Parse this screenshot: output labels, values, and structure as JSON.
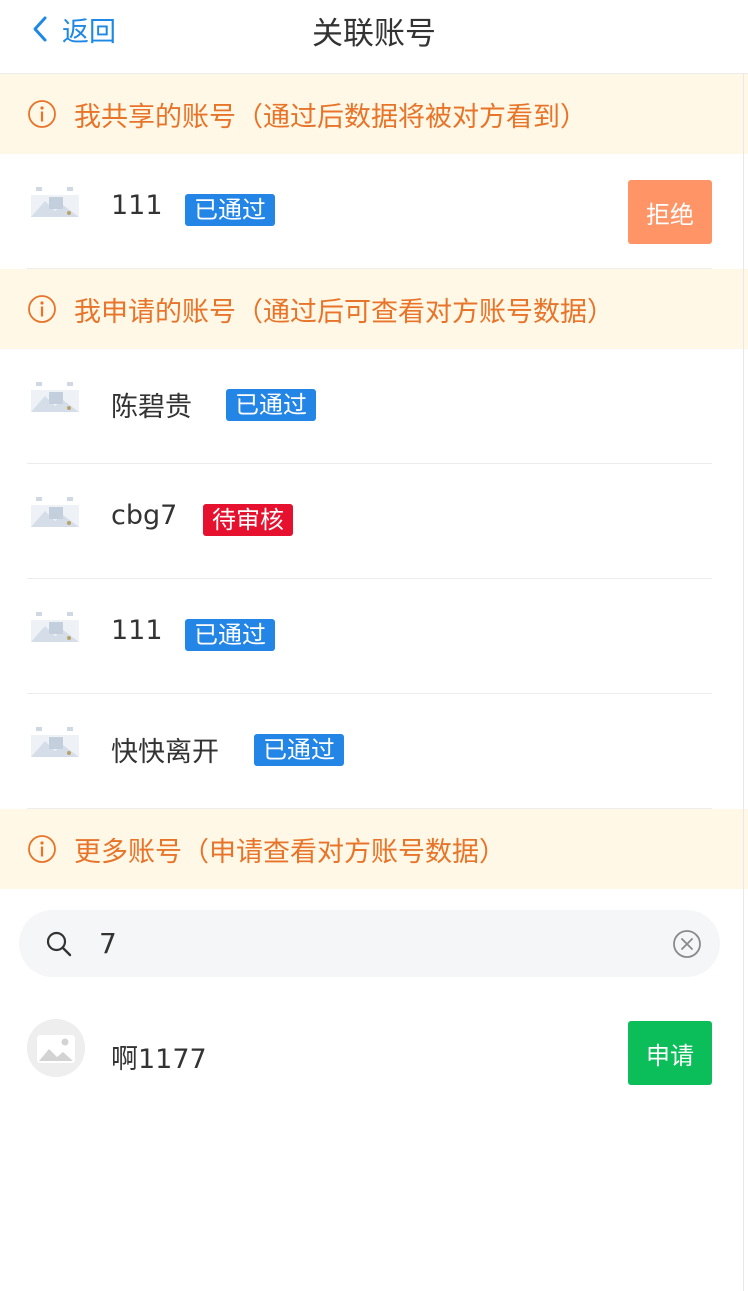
{
  "header": {
    "back_label": "返回",
    "title": "关联账号"
  },
  "sections": {
    "shared": {
      "notice": "我共享的账号（通过后数据将被对方看到）"
    },
    "applied": {
      "notice": "我申请的账号（通过后可查看对方账号数据）"
    },
    "more": {
      "notice": "更多账号（申请查看对方账号数据）"
    }
  },
  "shared_accounts": [
    {
      "name": "111",
      "status": "已通过",
      "action": "拒绝"
    }
  ],
  "applied_accounts": [
    {
      "name": "陈碧贵",
      "status": "已通过"
    },
    {
      "name": "cbg7",
      "status": "待审核"
    },
    {
      "name": "111",
      "status": "已通过"
    },
    {
      "name": "快快离开",
      "status": "已通过"
    }
  ],
  "search": {
    "value": "7"
  },
  "results": [
    {
      "name": "啊1177",
      "action": "申请"
    }
  ],
  "colors": {
    "accent": "#1e88e5",
    "notice_bg": "#fff8e6",
    "notice_text": "#e8742a",
    "badge_pass": "#2385e6",
    "badge_pending": "#e5112e",
    "reject_button": "#ff9467",
    "apply_button": "#0bbe5a"
  },
  "icons": {
    "back": "chevron-left-icon",
    "notice": "info-circle-icon",
    "search": "search-icon",
    "clear": "clear-circle-icon",
    "thumb": "account-thumbnail-icon",
    "avatar": "image-placeholder-icon"
  }
}
